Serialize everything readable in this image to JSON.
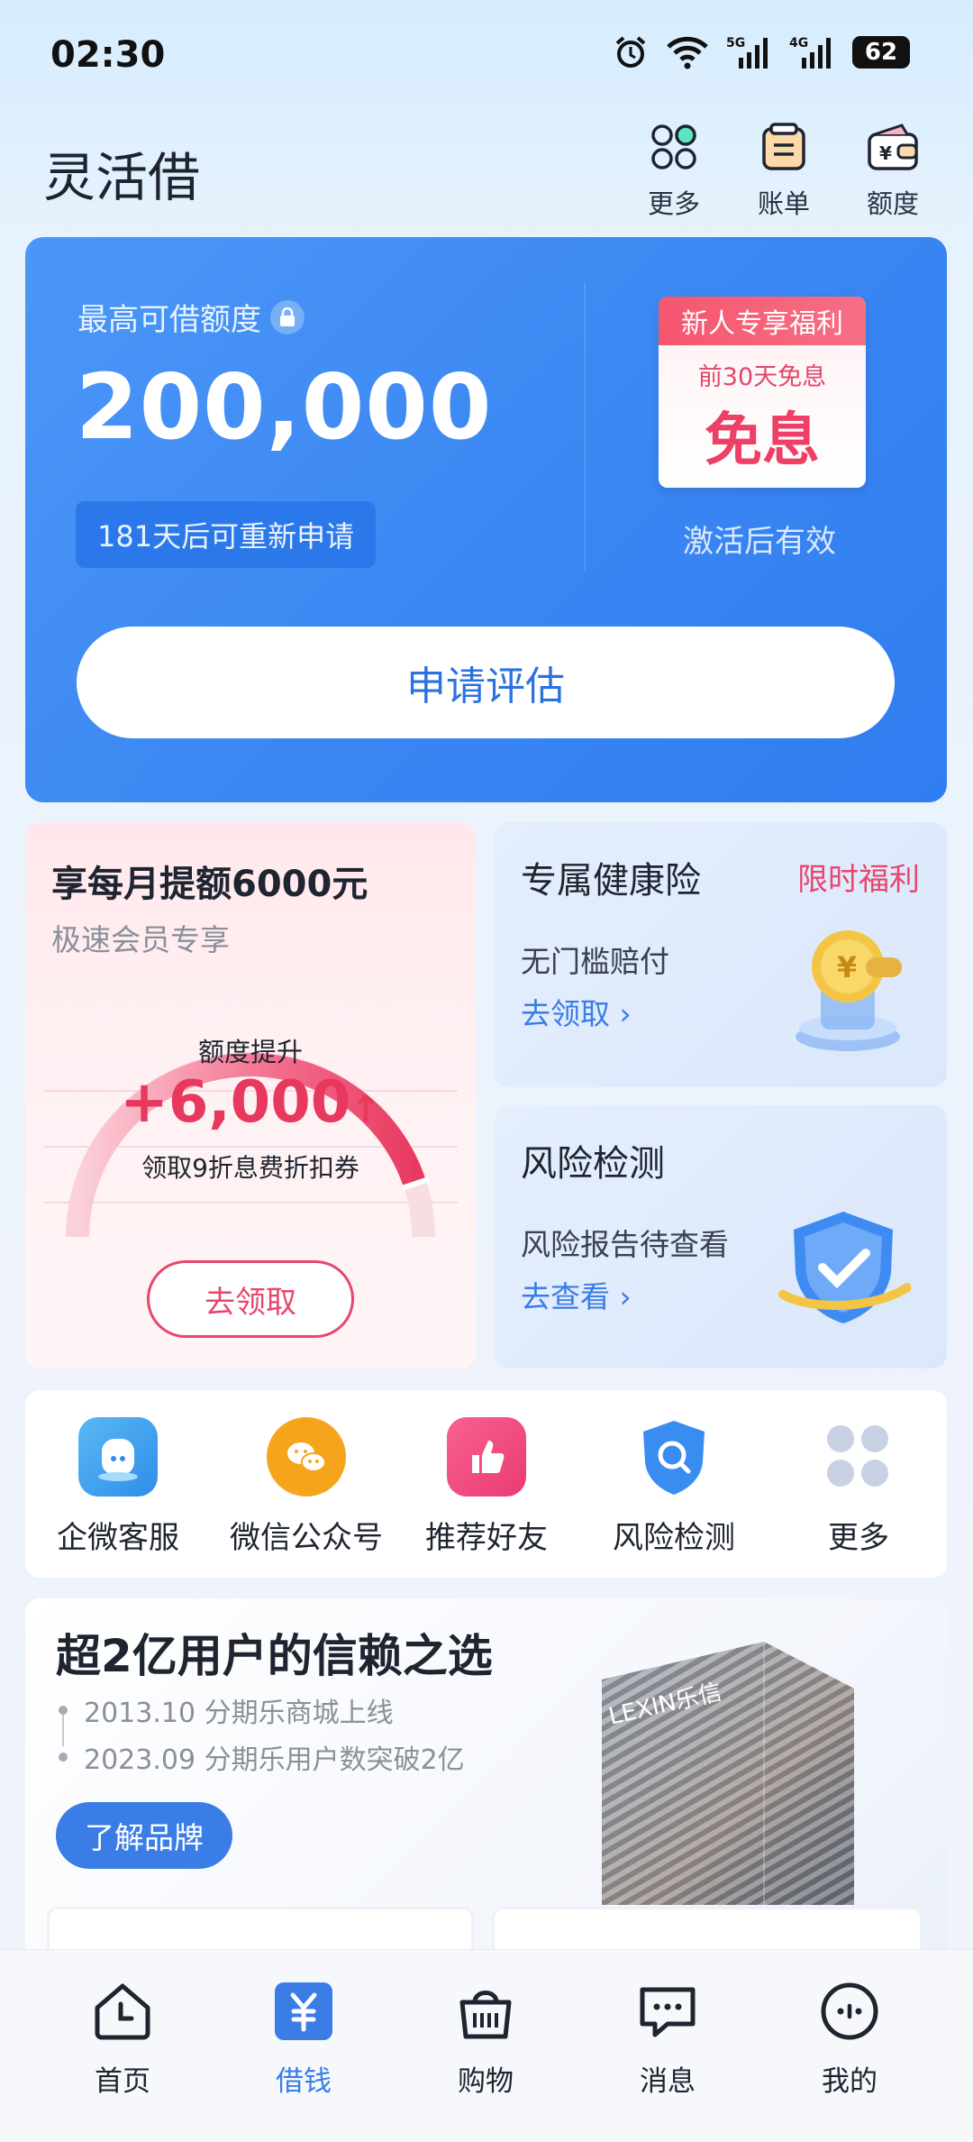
{
  "status": {
    "time": "02:30",
    "battery": "62",
    "network1": "5G",
    "network2": "4G"
  },
  "header": {
    "title": "灵活借",
    "buttons": [
      {
        "label": "更多",
        "icon": "grid-icon"
      },
      {
        "label": "账单",
        "icon": "bill-icon"
      },
      {
        "label": "额度",
        "icon": "wallet-icon"
      }
    ]
  },
  "hero": {
    "label": "最高可借额度",
    "amount": "200,000",
    "reapply": "181天后可重新申请",
    "coupon_tag": "新人专享福利",
    "coupon_sub": "前30天免息",
    "coupon_main": "免息",
    "coupon_note": "激活后有效",
    "apply_button": "申请评估"
  },
  "promo": {
    "title": "享每月提额6000元",
    "subtitle": "极速会员专享",
    "gauge_label": "额度提升",
    "gauge_value": "+6,000",
    "gauge_desc": "领取9折息费折扣券",
    "button": "去领取"
  },
  "insurance": {
    "title": "专属健康险",
    "tag": "限时福利",
    "desc": "无门槛赔付",
    "link": "去领取"
  },
  "risk": {
    "title": "风险检测",
    "desc": "风险报告待查看",
    "link": "去查看"
  },
  "quick_actions": [
    {
      "label": "企微客服",
      "icon": "customer-service-icon",
      "color": "#4aa8f0"
    },
    {
      "label": "微信公众号",
      "icon": "wechat-icon",
      "color": "#f7a41d"
    },
    {
      "label": "推荐好友",
      "icon": "thumbs-up-icon",
      "color": "#f0457a"
    },
    {
      "label": "风险检测",
      "icon": "shield-search-icon",
      "color": "#3a8df0"
    },
    {
      "label": "更多",
      "icon": "more-grid-icon",
      "color": "#c8d2e4"
    }
  ],
  "brand": {
    "title": "超2亿用户的信赖之选",
    "timeline": [
      "2013.10 分期乐商城上线",
      "2023.09 分期乐用户数突破2亿"
    ],
    "button": "了解品牌",
    "building_sign": "LEXIN乐信"
  },
  "bottom_nav": [
    {
      "label": "首页",
      "icon": "home-icon",
      "active": false
    },
    {
      "label": "借钱",
      "icon": "yuan-icon",
      "active": true
    },
    {
      "label": "购物",
      "icon": "shopping-bag-icon",
      "active": false
    },
    {
      "label": "消息",
      "icon": "message-icon",
      "active": false
    },
    {
      "label": "我的",
      "icon": "profile-icon",
      "active": false
    }
  ],
  "colors": {
    "primary": "#3a86f2",
    "accent_pink": "#e8466d",
    "link_blue": "#3a7de6"
  }
}
